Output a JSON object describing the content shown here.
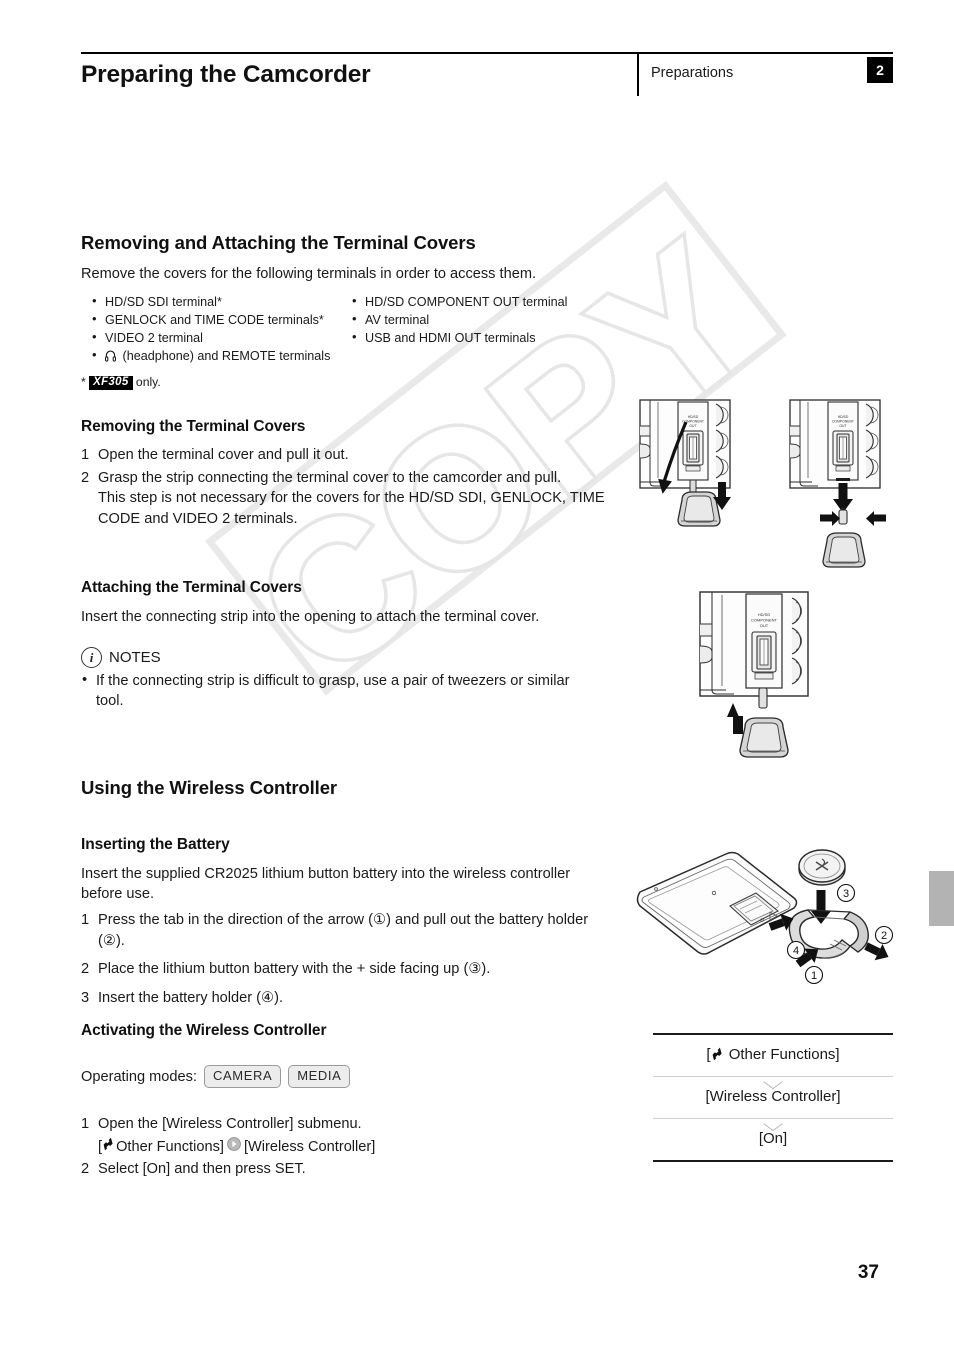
{
  "header": {
    "title": "Preparing the Camcorder",
    "chapter_name": "Preparations",
    "chapter_number": "2"
  },
  "section_terminals": {
    "heading": "Removing and Attaching the Terminal Covers",
    "intro": "Remove the covers for the following terminals in order to access them.",
    "bullets_left": [
      "HD/SD SDI terminal*",
      "GENLOCK and TIME CODE terminals*",
      "VIDEO 2 terminal",
      "(headphone) and REMOTE terminals"
    ],
    "bullets_right": [
      "HD/SD COMPONENT OUT terminal",
      "AV terminal",
      "USB and HDMI OUT terminals"
    ],
    "footnote_marker": "*",
    "footnote_badge": "XF305",
    "footnote_text": "only."
  },
  "removing": {
    "heading": "Removing the Terminal Covers",
    "steps": [
      {
        "num": "1",
        "text": "Open the terminal cover and pull it out."
      },
      {
        "num": "2",
        "text": "Grasp the strip connecting the terminal cover to the camcorder and pull.\nThis step is not necessary for the covers for the HD/SD SDI, GENLOCK, TIME CODE and VIDEO 2 terminals."
      }
    ]
  },
  "attaching": {
    "heading": "Attaching the Terminal Covers",
    "text": "Insert the connecting strip into the opening to attach the terminal cover.",
    "notes_label": "NOTES",
    "notes": [
      "If the connecting strip is difficult to grasp, use a pair of tweezers or similar tool."
    ]
  },
  "section_wireless": {
    "heading": "Using the Wireless Controller"
  },
  "inserting_battery": {
    "heading": "Inserting the Battery",
    "intro": "Insert the supplied CR2025 lithium button battery into the wireless controller before use.",
    "steps": [
      {
        "num": "1",
        "text": "Press the tab in the direction of the arrow (①) and pull out the battery holder (②)."
      },
      {
        "num": "2",
        "text": "Place the lithium button battery with the + side facing up (③)."
      },
      {
        "num": "3",
        "text": "Insert the battery holder (④)."
      }
    ]
  },
  "activating": {
    "heading": "Activating the Wireless Controller",
    "operating_modes_label": "Operating modes:",
    "modes": [
      "CAMERA",
      "MEDIA"
    ],
    "steps": [
      {
        "num": "1",
        "text": "Open the [Wireless Controller] submenu."
      },
      {
        "num": "2",
        "text": "Select [On] and then press SET."
      }
    ],
    "menu_path_open": "[",
    "menu_path_first": " Other Functions]",
    "menu_path_second": "[Wireless Controller]"
  },
  "menu_flow": {
    "items": [
      {
        "label": "Other Functions",
        "bracketed": true,
        "has_wrench": true
      },
      {
        "label": "[Wireless Controller]",
        "bracketed": false,
        "has_wrench": false
      },
      {
        "label": "[On]",
        "bracketed": false,
        "has_wrench": false
      }
    ],
    "item1_prefix": "[",
    "item1_suffix": " Other Functions]",
    "item2": "[Wireless Controller]",
    "item3": "[On]"
  },
  "watermark": {
    "text": "COPY"
  },
  "footer": {
    "page_number": "37"
  },
  "illustrations": {
    "terminal_open": "camcorder-terminal-cover-open-diagram",
    "terminal_pull": "camcorder-terminal-cover-pull-diagram",
    "terminal_attach": "camcorder-terminal-cover-attach-diagram",
    "remote_battery": "wireless-controller-battery-diagram",
    "callouts": [
      "①",
      "②",
      "③",
      "④"
    ]
  }
}
